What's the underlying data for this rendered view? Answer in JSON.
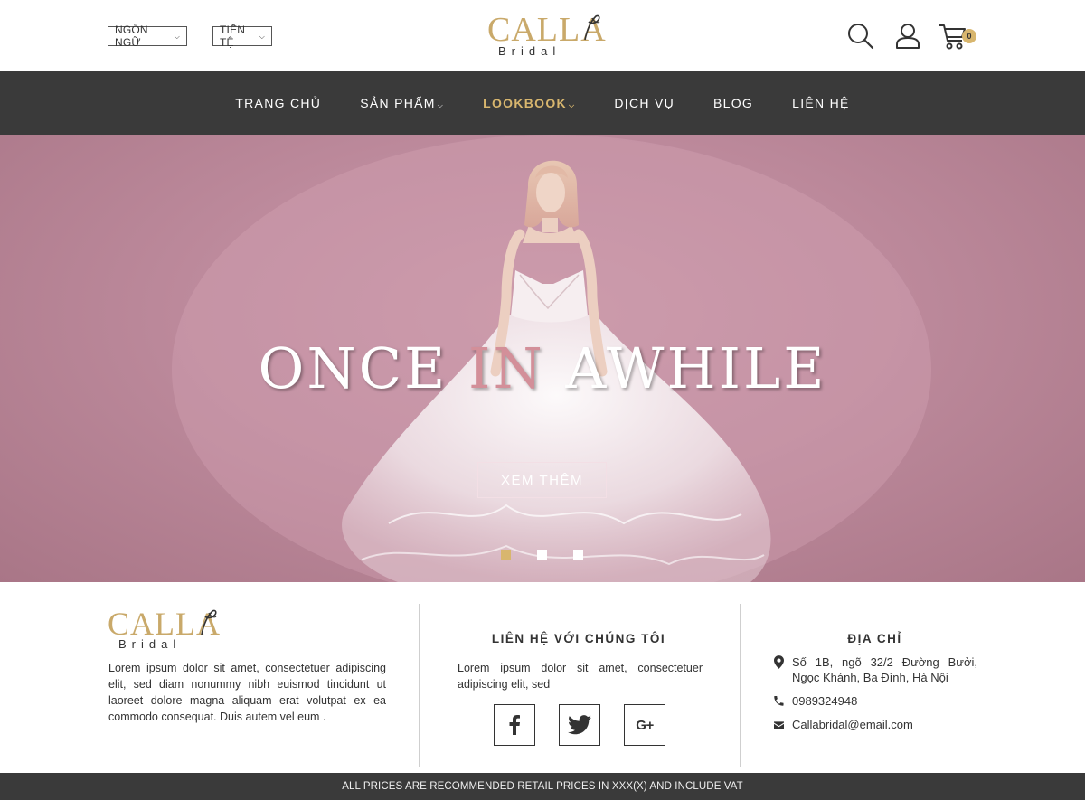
{
  "header": {
    "language_label": "NGÔN NGỮ",
    "currency_label": "TIỀN TỆ",
    "logo_main": "CALLA",
    "logo_sub": "Bridal",
    "cart_count": "0"
  },
  "nav": {
    "items": [
      {
        "label": "TRANG CHỦ"
      },
      {
        "label": "SẢN PHẨM"
      },
      {
        "label": "LOOKBOOK"
      },
      {
        "label": "DỊCH VỤ"
      },
      {
        "label": "BLOG"
      },
      {
        "label": "LIÊN HỆ"
      }
    ]
  },
  "hero": {
    "title_part1": "ONCE ",
    "title_highlight": "IN",
    "title_part2": " AWHILE",
    "button_label": "XEM THÊM",
    "slides": 3,
    "active_slide": 1
  },
  "footer": {
    "logo_main": "CALLA",
    "logo_sub": "Bridal",
    "about_text": "Lorem ipsum dolor sit amet, consectetuer adipiscing elit, sed diam nonummy nibh euismod tincidunt ut laoreet dolore magna aliquam erat volutpat ex ea commodo consequat. Duis autem vel eum .",
    "contact_heading": "LIÊN HỆ VỚI CHÚNG TÔI",
    "contact_text": "Lorem ipsum dolor sit amet, consectetuer adipiscing elit, sed",
    "address_heading": "ĐỊA CHỈ",
    "address": "Số 1B, ngõ 32/2 Đường Bưởi, Ngọc Khánh, Ba Đình, Hà Nội",
    "phone": "0989324948",
    "email": "Callabridal@email.com"
  },
  "notice": "ALL PRICES ARE RECOMMENDED RETAIL PRICES IN XXX(X) AND INCLUDE VAT",
  "colors": {
    "accent_gold": "#d8b66e",
    "nav_bg": "#3a3a3a",
    "hero_pink": "#c796a6",
    "title_highlight": "#d38f99"
  }
}
